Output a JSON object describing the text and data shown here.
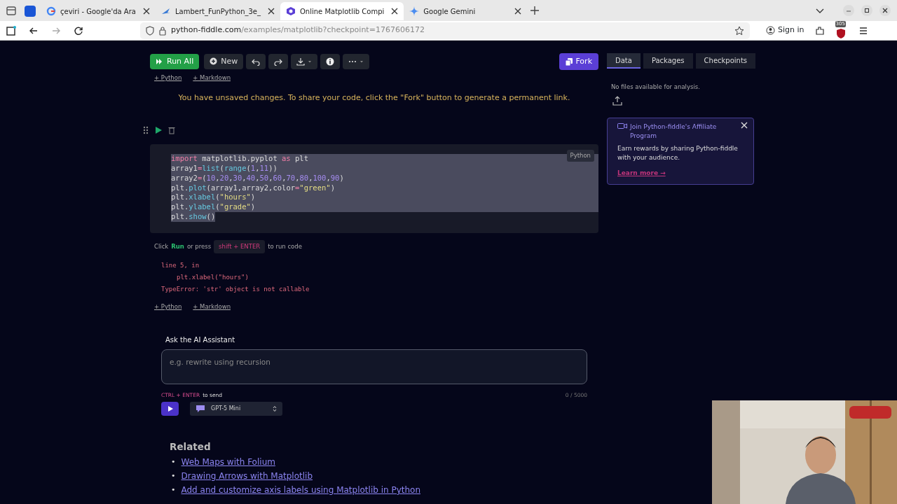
{
  "browser": {
    "tabs": [
      {
        "kind": "pinned",
        "selected": false
      },
      {
        "title": "çeviri - Google'da Ara",
        "kind": "google",
        "selected": false
      },
      {
        "title": "Lambert_FunPython_3e_",
        "kind": "doc",
        "selected": false
      },
      {
        "title": "Online Matplotlib Compi",
        "kind": "fiddle",
        "selected": true
      },
      {
        "title": "Google Gemini",
        "kind": "gemini",
        "selected": false
      }
    ],
    "url": {
      "host": "python-fiddle.com",
      "path": "/examples/matplotlib?checkpoint=1767606172"
    },
    "sign_in": "Sign in",
    "extension_badge": "305"
  },
  "toolbar": {
    "buttons": [
      {
        "label": "Run All",
        "kind": "run"
      },
      {
        "label": "New",
        "kind": "new"
      },
      {
        "kind": "undo"
      },
      {
        "kind": "redo"
      },
      {
        "kind": "download"
      },
      {
        "kind": "info"
      },
      {
        "kind": "more"
      }
    ],
    "fork": "Fork"
  },
  "add_cell_top": [
    "+ Python",
    "+ Markdown"
  ],
  "notice": "You have unsaved changes. To share your code, click the \"Fork\" button to generate a permanent link.",
  "cell": {
    "language": "Python",
    "lines": [
      {
        "text": "import matplotlib.pyplot as plt",
        "selected": true
      },
      {
        "text": "array1=list(range(1,11))",
        "selected": true
      },
      {
        "text": "array2=(10,20,30,40,50,60,70,80,100,90)",
        "selected": true
      },
      {
        "text": "plt.plot(array1,array2,color=\"green\")",
        "selected": true
      },
      {
        "text": "plt.xlabel(\"hours\")",
        "selected": true
      },
      {
        "text": "plt.ylabel(\"grade\")",
        "selected": true
      },
      {
        "text": "plt.show()",
        "selected": true
      }
    ],
    "hint": {
      "before": "Click",
      "run": "Run",
      "middle": "or press",
      "key": "shift + ENTER",
      "after": "to run code"
    },
    "output": [
      {
        "text": "line 5, in",
        "indent": false
      },
      {
        "text": "plt.xlabel(\"hours\")",
        "indent": true
      },
      {
        "text": "TypeError: 'str' object is not callable",
        "indent": false
      }
    ]
  },
  "add_cell_bottom": [
    "+ Python",
    "+ Markdown"
  ],
  "assistant": {
    "title": "Ask the AI Assistant",
    "placeholder": "e.g. rewrite using recursion",
    "shortcut": "CTRL + ENTER",
    "shortcut_suffix": "to send",
    "counter": "0 / 5000",
    "model": "GPT-5 Mini"
  },
  "related": {
    "title": "Related",
    "links": [
      {
        "bullet": "•",
        "text": "Web Maps with Folium"
      },
      {
        "bullet": "•",
        "text": "Drawing Arrows with Matplotlib"
      },
      {
        "bullet": "•",
        "text": "Add and customize axis labels using Matplotlib in Python"
      }
    ]
  },
  "side": {
    "tabs": [
      {
        "label": "Data",
        "selected": true
      },
      {
        "label": "Packages",
        "selected": false
      },
      {
        "label": "Checkpoints",
        "selected": false
      }
    ],
    "empty_text": "No files available for analysis.",
    "banner": {
      "title": "Join Python-fiddle's Affiliate Program",
      "body": "Earn rewards by sharing Python-fiddle with your audience.",
      "link": "Learn more →"
    }
  },
  "webcam": {
    "kind": "picture"
  }
}
